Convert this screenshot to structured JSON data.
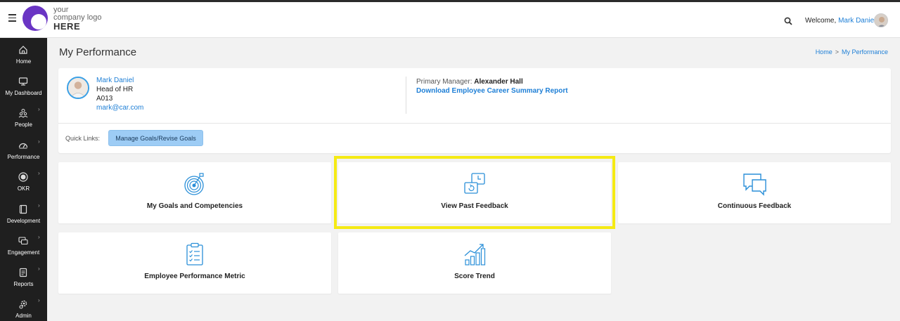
{
  "header": {
    "logo_line1": "your",
    "logo_line2": "company logo",
    "logo_line3": "HERE",
    "welcome_prefix": "Welcome,",
    "user_name": "Mark Daniel"
  },
  "sidebar": {
    "items": [
      {
        "label": "Home",
        "icon": "home-icon",
        "has_chevron": false
      },
      {
        "label": "My Dashboard",
        "icon": "monitor-icon",
        "has_chevron": false
      },
      {
        "label": "People",
        "icon": "people-icon",
        "has_chevron": true
      },
      {
        "label": "Performance",
        "icon": "gauge-icon",
        "has_chevron": true
      },
      {
        "label": "OKR",
        "icon": "okr-icon",
        "has_chevron": true
      },
      {
        "label": "Development",
        "icon": "book-icon",
        "has_chevron": true
      },
      {
        "label": "Engagement",
        "icon": "chat-icon",
        "has_chevron": true
      },
      {
        "label": "Reports",
        "icon": "report-icon",
        "has_chevron": true
      },
      {
        "label": "Admin",
        "icon": "gear-icon",
        "has_chevron": true
      }
    ]
  },
  "page": {
    "title": "My Performance",
    "breadcrumb": [
      "Home",
      "My Performance"
    ],
    "breadcrumb_sep": ">"
  },
  "profile": {
    "name": "Mark Daniel",
    "role": "Head of HR",
    "code": "A013",
    "email": "mark@car.com",
    "manager_label": "Primary Manager:",
    "manager_name": "Alexander Hall",
    "download_link": "Download Employee Career Summary Report",
    "quick_links_label": "Quick Links:",
    "quick_link_button": "Manage Goals/Revise Goals"
  },
  "tiles": [
    {
      "label": "My Goals and Competencies",
      "icon": "target-icon"
    },
    {
      "label": "View Past Feedback",
      "icon": "feedback-history-icon",
      "highlighted": true
    },
    {
      "label": "Continuous Feedback",
      "icon": "chat-bubbles-icon"
    },
    {
      "label": "Employee Performance Metric",
      "icon": "clipboard-checklist-icon"
    },
    {
      "label": "Score Trend",
      "icon": "bar-trend-icon"
    }
  ],
  "colors": {
    "accent": "#1e7fd6",
    "sidebar_bg": "#1f1f1f",
    "highlight": "#f5ea14",
    "quick_link_bg": "#9dccf5",
    "logo_purple": "#6a35c4"
  }
}
